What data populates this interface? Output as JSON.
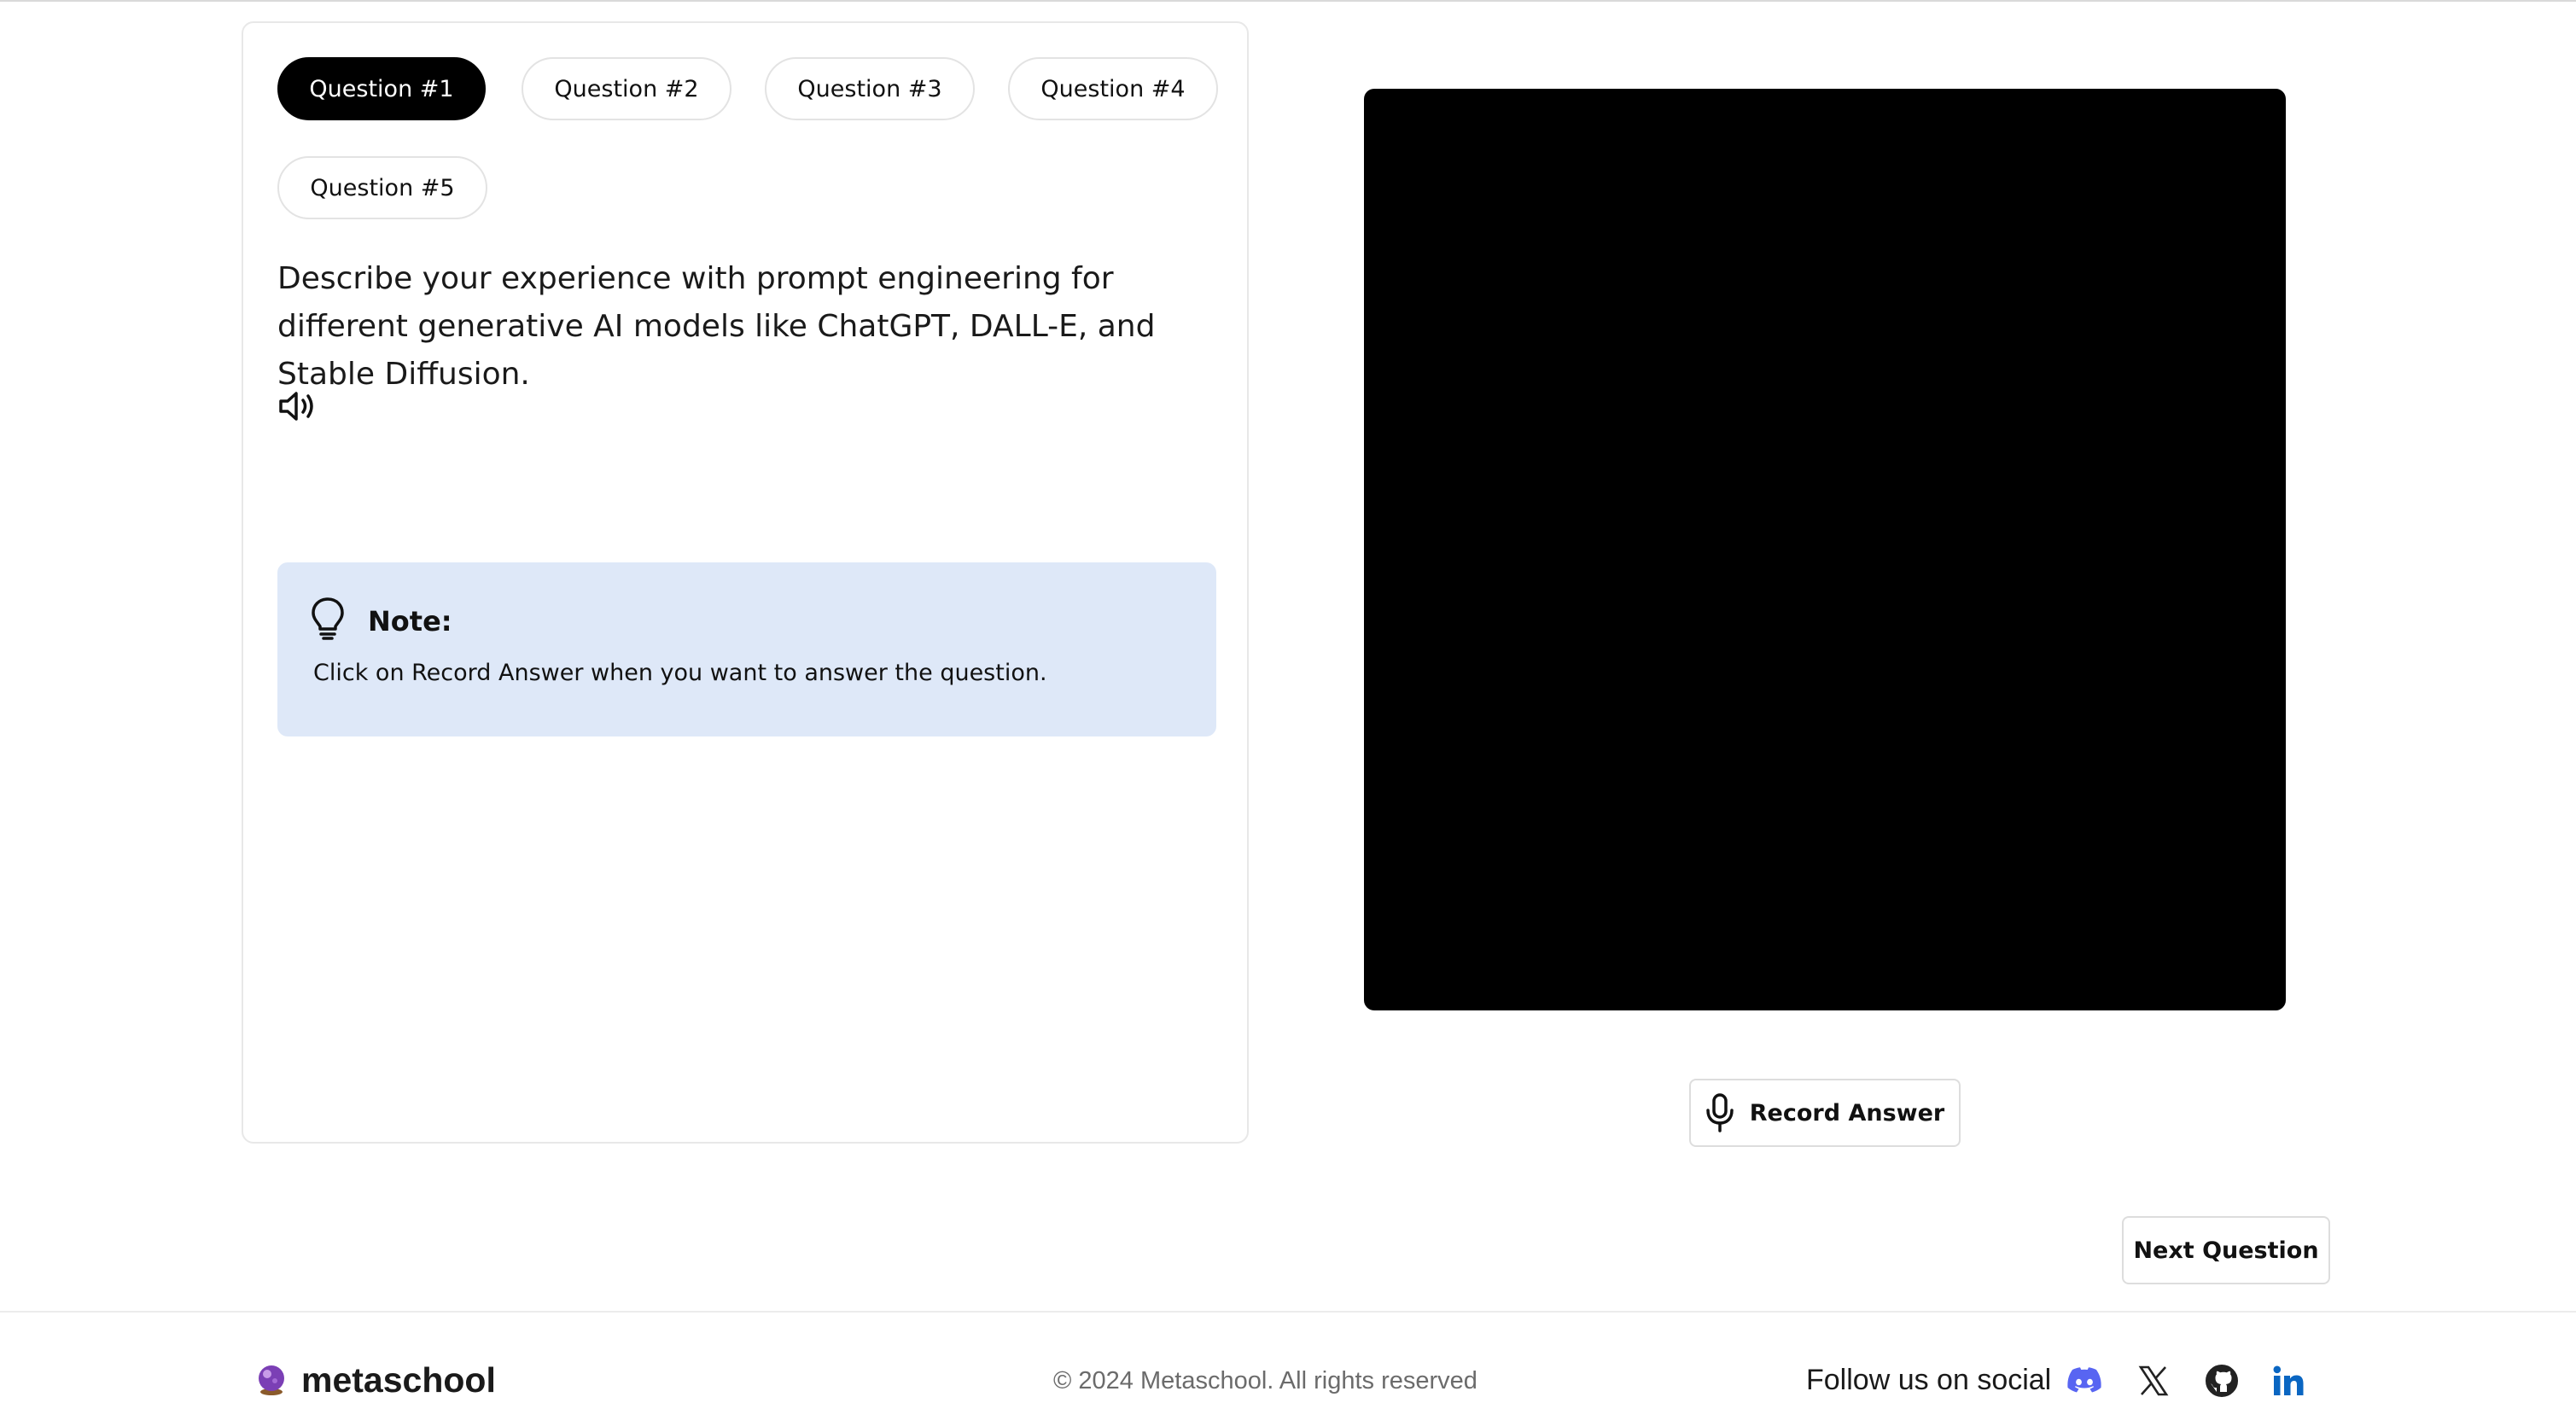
{
  "questions": {
    "tabs": [
      {
        "label": "Question #1",
        "active": true
      },
      {
        "label": "Question #2",
        "active": false
      },
      {
        "label": "Question #3",
        "active": false
      },
      {
        "label": "Question #4",
        "active": false
      },
      {
        "label": "Question #5",
        "active": false
      }
    ],
    "current_text": "Describe your experience with prompt engineering for different generative AI models like ChatGPT, DALL-E, and Stable Diffusion.",
    "speaker_icon": "speaker-icon"
  },
  "note": {
    "icon": "lightbulb-icon",
    "title": "Note:",
    "text": "Click on Record Answer when you want to answer the question.",
    "background": "#dee8f8"
  },
  "recorder": {
    "record_label": "Record Answer",
    "record_icon": "microphone-icon",
    "next_label": "Next Question"
  },
  "footer": {
    "brand": "metaschool",
    "copyright": "© 2024 Metaschool. All rights reserved",
    "follow_label": "Follow us on social",
    "social": [
      "discord-icon",
      "x-icon",
      "github-icon",
      "linkedin-icon"
    ]
  },
  "colors": {
    "active_tab": "#000000",
    "video_bg": "#000000",
    "discord": "#5865f2",
    "linkedin": "#0a66c2"
  }
}
